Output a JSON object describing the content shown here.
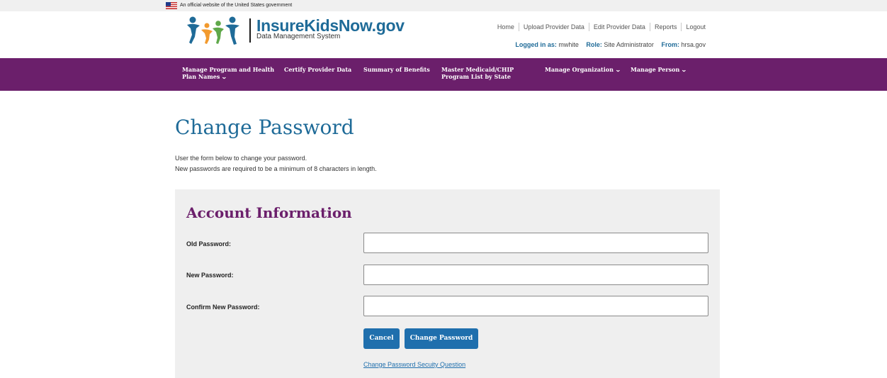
{
  "banner": {
    "text": "An official website of the United States government",
    "flag_icon": "us-flag-icon"
  },
  "header": {
    "site_name": "InsureKidsNow.gov",
    "subtitle": "Data Management System",
    "logo_icon": "family-logo-icon",
    "util_links": [
      "Home",
      "Upload Provider Data",
      "Edit Provider Data",
      "Reports",
      "Logout"
    ],
    "login": {
      "logged_in_label": "Logged in as:",
      "user": "mwhite",
      "role_label": "Role:",
      "role": "Site Administrator",
      "from_label": "From:",
      "from": "hrsa.gov"
    }
  },
  "nav": {
    "manage_program_line1": "Manage Program and Health",
    "manage_program_line2": "Plan Names",
    "certify": "Certify Provider Data",
    "summary": "Summary of Benefits",
    "master_line1": "Master Medicaid/CHIP",
    "master_line2": "Program List by State",
    "manage_org": "Manage Organization",
    "manage_person": "Manage Person",
    "chevron_icon": "chevron-down-icon"
  },
  "page": {
    "title": "Change Password",
    "intro_line1": "User the form below to change your password.",
    "intro_line2": "New passwords are required to be a minimum of 8 characters in length."
  },
  "form": {
    "section_title": "Account Information",
    "old_password_label": "Old Password:",
    "old_password_value": "",
    "new_password_label": "New Password:",
    "new_password_value": "",
    "confirm_password_label": "Confirm New Password:",
    "confirm_password_value": "",
    "cancel_label": "Cancel",
    "submit_label": "Change Password",
    "security_link": "Change Password Secuity Question"
  },
  "colors": {
    "brand_blue": "#1f6b98",
    "nav_purple": "#6b1f6b",
    "button_blue": "#1f6fad",
    "panel_gray": "#efefef"
  }
}
